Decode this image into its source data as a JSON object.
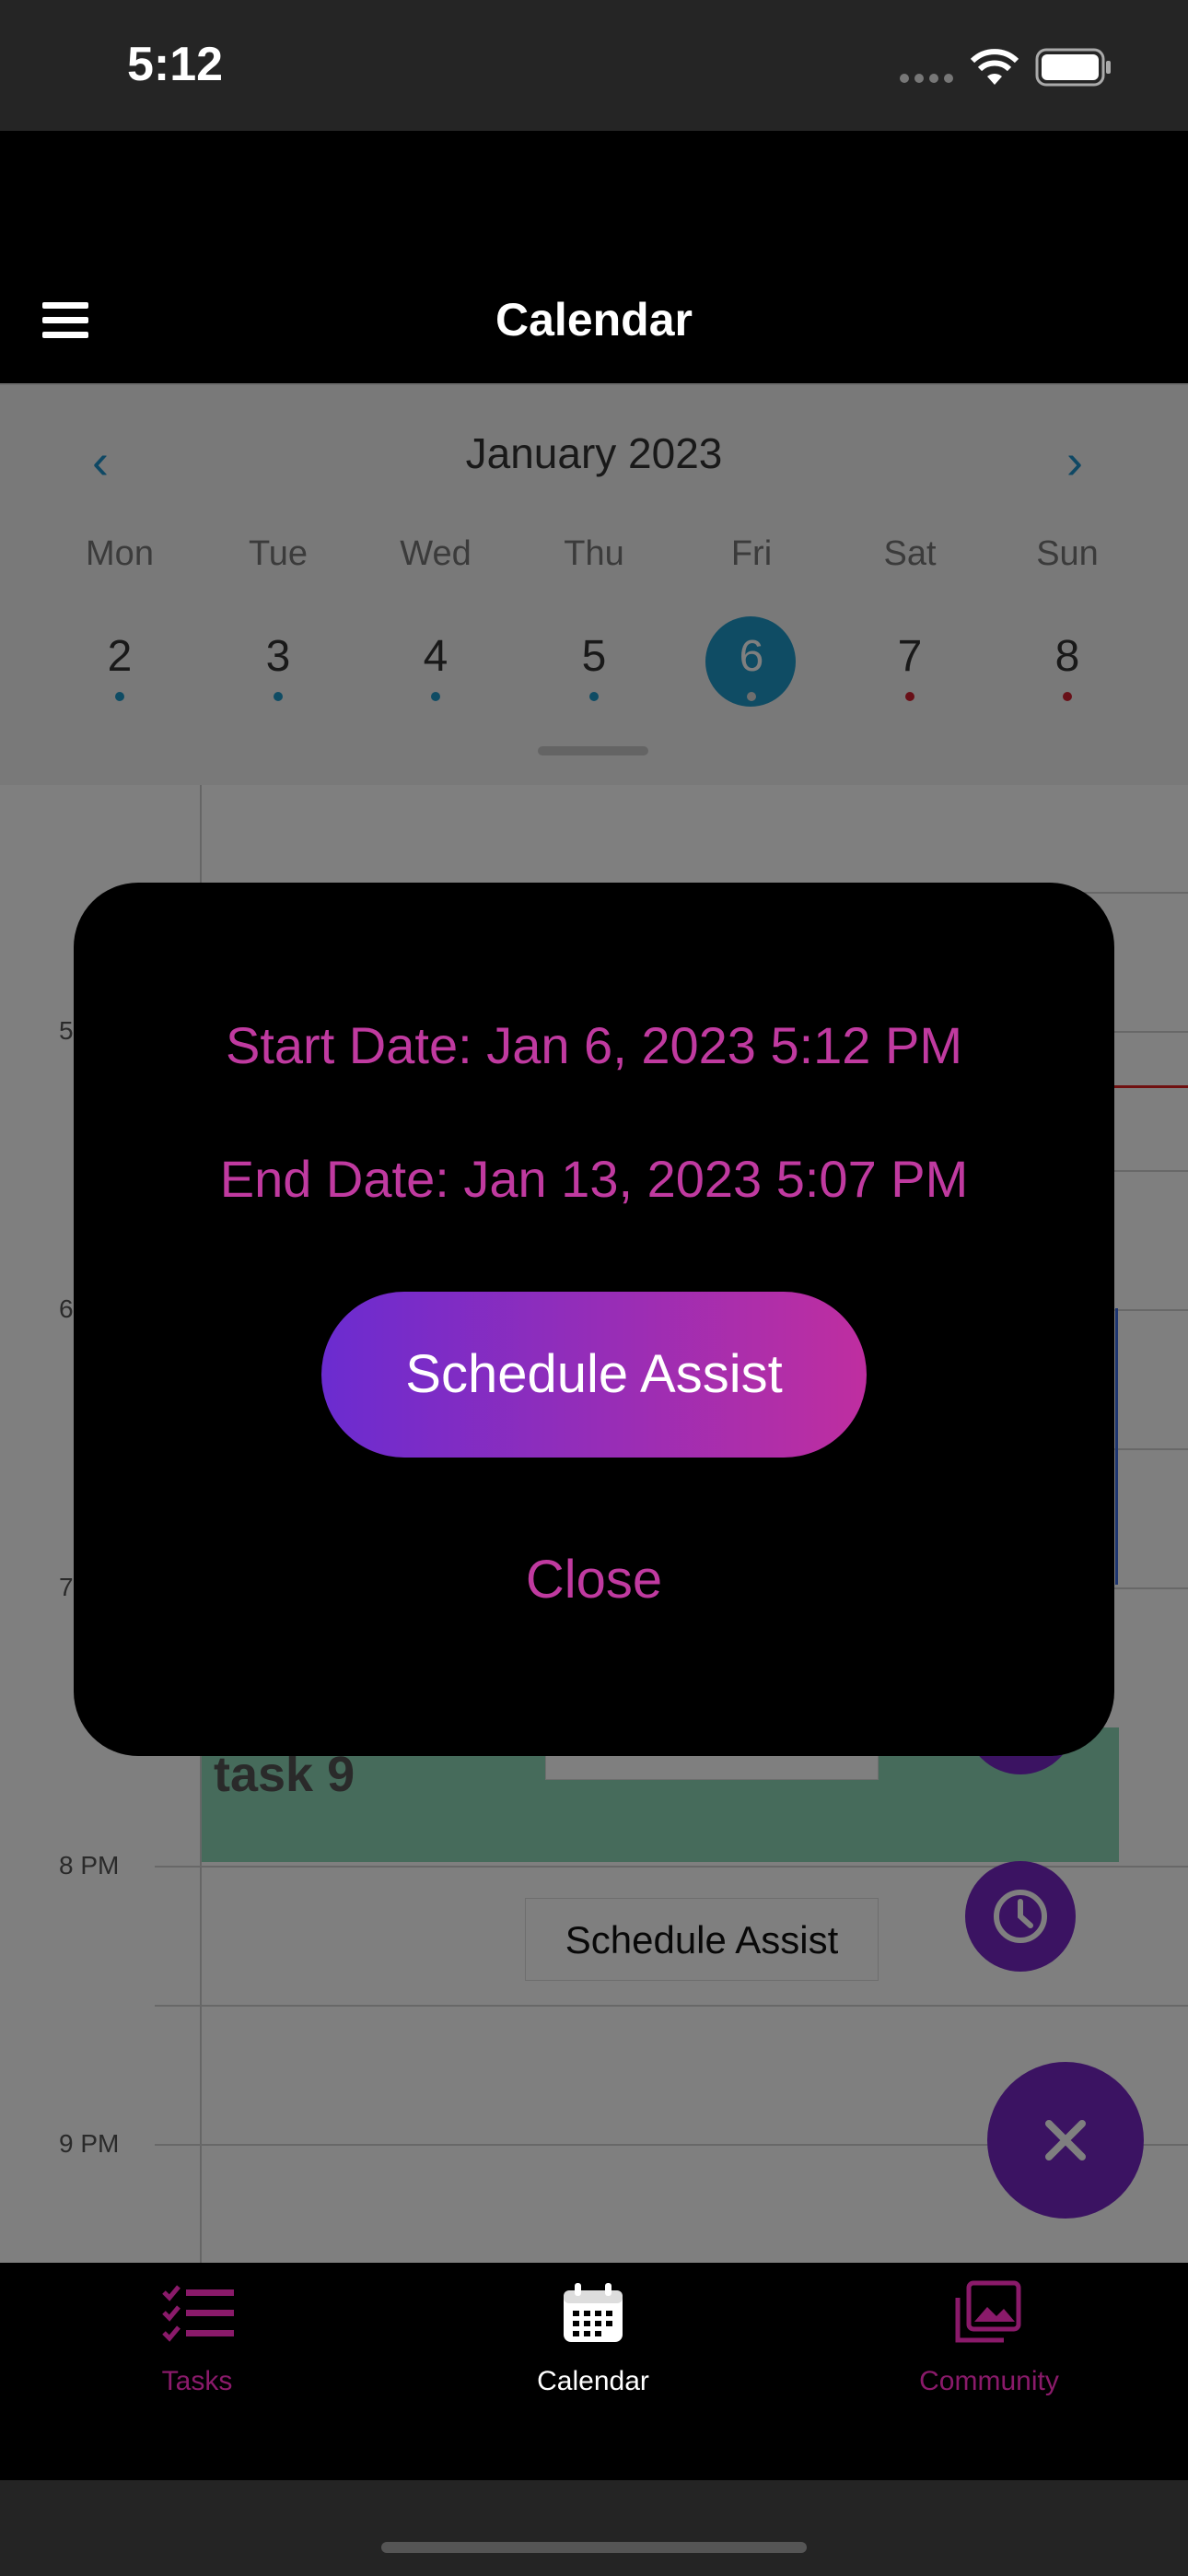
{
  "status_bar": {
    "time": "5:12"
  },
  "nav": {
    "title": "Calendar"
  },
  "calendar": {
    "month": "January 2023",
    "day_names": [
      "Mon",
      "Tue",
      "Wed",
      "Thu",
      "Fri",
      "Sat",
      "Sun"
    ],
    "dates": [
      "2",
      "3",
      "4",
      "5",
      "6",
      "7",
      "8"
    ],
    "selected_date": "6"
  },
  "timeline": {
    "hours": [
      "5",
      "6",
      "7",
      "8 PM",
      "9 PM"
    ],
    "task_label": "task 9",
    "schedule_assist_chip": "Schedule Assist"
  },
  "modal": {
    "start_date": "Start Date: Jan 6, 2023 5:12 PM",
    "end_date": "End Date: Jan 13, 2023 5:07 PM",
    "schedule_assist_label": "Schedule Assist",
    "close_label": "Close"
  },
  "tabs": [
    {
      "label": "Tasks",
      "icon": "checklist-icon",
      "active": false
    },
    {
      "label": "Calendar",
      "icon": "calendar-icon",
      "active": true
    },
    {
      "label": "Community",
      "icon": "photo-gallery-icon",
      "active": false
    }
  ],
  "colors": {
    "accent": "#c03aa0",
    "purple": "#7626c4",
    "blue": "#1e98c8"
  }
}
